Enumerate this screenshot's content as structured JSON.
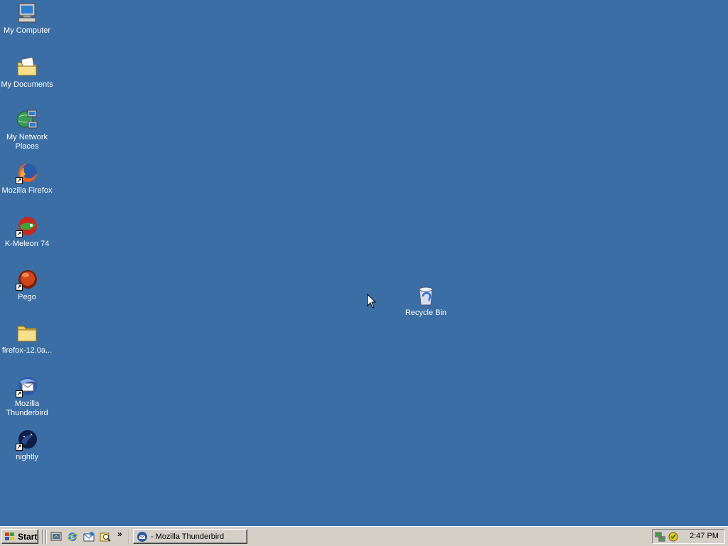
{
  "desktop": {
    "background": "#3a6ea5",
    "icons": [
      {
        "label": "My Computer",
        "icon": "my-computer-icon"
      },
      {
        "label": "My Documents",
        "icon": "my-documents-icon"
      },
      {
        "label": "My Network Places",
        "icon": "network-places-icon"
      },
      {
        "label": "Mozilla Firefox",
        "icon": "firefox-icon",
        "shortcut": true
      },
      {
        "label": "K-Meleon 74",
        "icon": "k-meleon-icon",
        "shortcut": true
      },
      {
        "label": "Pego",
        "icon": "pego-icon",
        "shortcut": true
      },
      {
        "label": "firefox-12.0a...",
        "icon": "folder-icon"
      },
      {
        "label": "Mozilla Thunderbird",
        "icon": "thunderbird-icon",
        "shortcut": true
      },
      {
        "label": "nightly",
        "icon": "nightly-icon",
        "shortcut": true
      },
      {
        "label": "Recycle Bin",
        "icon": "recycle-bin-icon"
      }
    ]
  },
  "taskbar": {
    "start_label": "Start",
    "quick_launch": [
      "show-desktop-icon",
      "internet-explorer-icon",
      "outlook-express-icon",
      "search-icon"
    ],
    "chevron": "»",
    "task_buttons": [
      {
        "label": "- Mozilla Thunderbird",
        "icon": "thunderbird-icon"
      }
    ],
    "tray_icons": [
      "network-connection-icon",
      "security-icon"
    ],
    "clock": "2:47 PM"
  }
}
